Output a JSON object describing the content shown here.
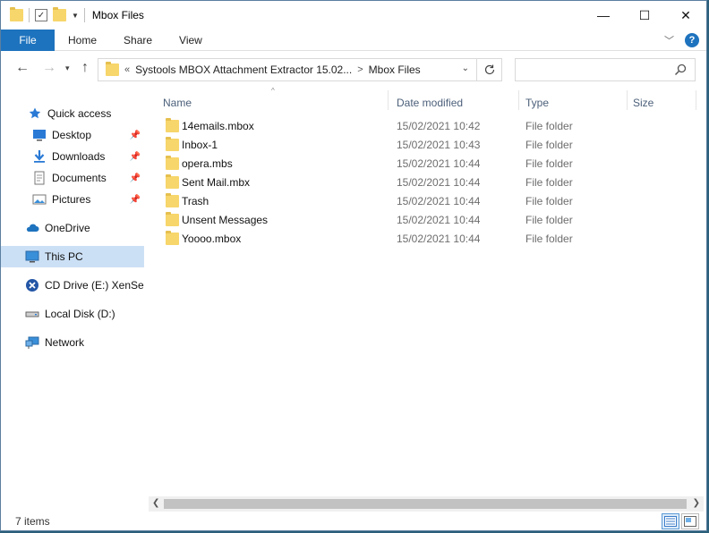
{
  "window": {
    "title": "Mbox Files",
    "controls": {
      "minimize": "—",
      "maximize": "☐",
      "close": "✕"
    }
  },
  "ribbon": {
    "tabs": [
      {
        "label": "File"
      },
      {
        "label": "Home"
      },
      {
        "label": "Share"
      },
      {
        "label": "View"
      }
    ],
    "help": "?"
  },
  "address": {
    "overflow": "«",
    "crumbs": [
      "Systools MBOX Attachment Extractor 15.02...",
      "Mbox Files"
    ],
    "separator": ">"
  },
  "search": {
    "placeholder": ""
  },
  "sidebar": {
    "items": [
      {
        "label": "Quick access",
        "icon": "star-icon"
      },
      {
        "label": "Desktop",
        "icon": "desktop-icon",
        "pinned": true
      },
      {
        "label": "Downloads",
        "icon": "download-icon",
        "pinned": true
      },
      {
        "label": "Documents",
        "icon": "document-icon",
        "pinned": true
      },
      {
        "label": "Pictures",
        "icon": "picture-icon",
        "pinned": true
      },
      {
        "label": "OneDrive",
        "icon": "cloud-icon"
      },
      {
        "label": "This PC",
        "icon": "computer-icon",
        "selected": true
      },
      {
        "label": "CD Drive (E:) XenServ",
        "icon": "cd-drive-icon"
      },
      {
        "label": "Local Disk (D:)",
        "icon": "disk-icon"
      },
      {
        "label": "Network",
        "icon": "network-icon"
      }
    ]
  },
  "columns": {
    "name": "Name",
    "date": "Date modified",
    "type": "Type",
    "size": "Size"
  },
  "files": [
    {
      "name": "14emails.mbox",
      "date": "15/02/2021 10:42",
      "type": "File folder"
    },
    {
      "name": "Inbox-1",
      "date": "15/02/2021 10:43",
      "type": "File folder"
    },
    {
      "name": "opera.mbs",
      "date": "15/02/2021 10:44",
      "type": "File folder"
    },
    {
      "name": "Sent Mail.mbx",
      "date": "15/02/2021 10:44",
      "type": "File folder"
    },
    {
      "name": "Trash",
      "date": "15/02/2021 10:44",
      "type": "File folder"
    },
    {
      "name": "Unsent Messages",
      "date": "15/02/2021 10:44",
      "type": "File folder"
    },
    {
      "name": "Yoooo.mbox",
      "date": "15/02/2021 10:44",
      "type": "File folder"
    }
  ],
  "status": {
    "item_count": "7 items"
  },
  "colors": {
    "accent": "#1e73be",
    "folder": "#f7d66b",
    "selection": "#cce0f5"
  }
}
